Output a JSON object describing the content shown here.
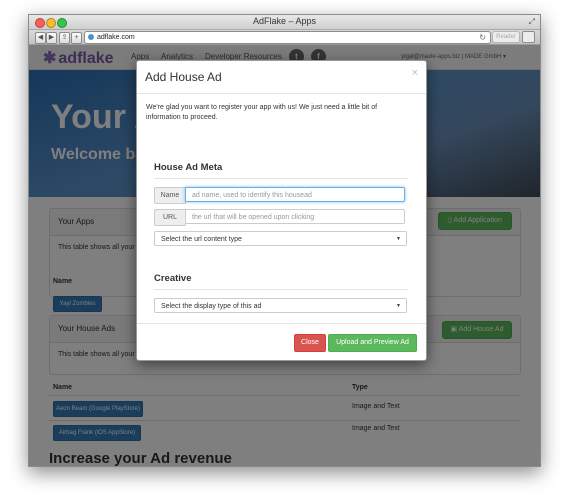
{
  "window": {
    "title": "AdFlake – Apps"
  },
  "browser": {
    "url": "adflake.com",
    "reader_label": "Reader"
  },
  "site": {
    "brand": "adflake",
    "nav": [
      "Apps",
      "Analytics",
      "Developer Resources"
    ],
    "account": "yigal@maxle-apps.biz | MADE GmbH ▾"
  },
  "hero": {
    "title": "Your A",
    "subtitle": "Welcome ba"
  },
  "apps_panel": {
    "title": "Your Apps",
    "button": "Add Application",
    "note": "This table shows all your",
    "col_name": "Name",
    "rows": [
      {
        "name": "Yayl Zombies"
      }
    ]
  },
  "ads_panel": {
    "title": "Your House Ads",
    "button": "Add House Ad",
    "note": "This table shows all your",
    "col_name": "Name",
    "col_type": "Type",
    "rows": [
      {
        "name": "Aeon Beam (Google PlayStore)",
        "type": "Image and Text"
      },
      {
        "name": "Airbag Frank (iOS AppStore)",
        "type": "Image and Text"
      }
    ]
  },
  "bottom_heading": "Increase your Ad revenue",
  "modal": {
    "title": "Add House Ad",
    "close_symbol": "×",
    "intro": "We're glad you want to register your app with us! We just need a little bit of information to proceed.",
    "meta_heading": "House Ad Meta",
    "name_label": "Name",
    "name_placeholder": "ad name, used to identify this housead",
    "url_label": "URL",
    "url_placeholder": "the url that will be opened upon clicking",
    "url_content_select": "Select the url content type",
    "creative_heading": "Creative",
    "display_type_select": "Select the display type of this ad",
    "close_button": "Close",
    "upload_button": "Upload and Preview Ad"
  },
  "colors": {
    "primary": "#337ab7",
    "success": "#5cb85c",
    "danger": "#d9534f",
    "brand": "#7a5aa6"
  }
}
